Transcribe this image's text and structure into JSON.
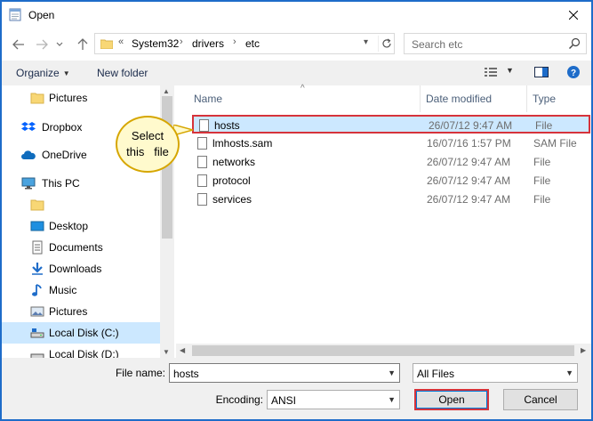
{
  "window": {
    "title": "Open"
  },
  "address": {
    "overflow": "«",
    "segments": [
      "System32",
      "drivers",
      "etc"
    ]
  },
  "search": {
    "placeholder": "Search etc"
  },
  "toolbar": {
    "organize": "Organize",
    "new_folder": "New folder"
  },
  "sidebar": {
    "items": [
      {
        "label": "Pictures",
        "icon": "folder-icon"
      },
      {
        "label": "Dropbox",
        "icon": "dropbox-icon"
      },
      {
        "label": "OneDrive",
        "icon": "onedrive-icon"
      },
      {
        "label": "This PC",
        "icon": "pc-icon"
      },
      {
        "label": "",
        "icon": "folder-icon"
      },
      {
        "label": "Desktop",
        "icon": "desktop-icon"
      },
      {
        "label": "Documents",
        "icon": "documents-icon"
      },
      {
        "label": "Downloads",
        "icon": "downloads-icon"
      },
      {
        "label": "Music",
        "icon": "music-icon"
      },
      {
        "label": "Pictures",
        "icon": "pictures-icon"
      },
      {
        "label": "Local Disk (C:)",
        "icon": "disk-icon",
        "selected": true
      },
      {
        "label": "Local Disk (D:)",
        "icon": "disk-icon"
      }
    ]
  },
  "columns": {
    "name": "Name",
    "date": "Date modified",
    "type": "Type"
  },
  "files": [
    {
      "name": "hosts",
      "date": "26/07/12 9:47 AM",
      "type": "File",
      "selected": true
    },
    {
      "name": "lmhosts.sam",
      "date": "16/07/16 1:57 PM",
      "type": "SAM File"
    },
    {
      "name": "networks",
      "date": "26/07/12 9:47 AM",
      "type": "File"
    },
    {
      "name": "protocol",
      "date": "26/07/12 9:47 AM",
      "type": "File"
    },
    {
      "name": "services",
      "date": "26/07/12 9:47 AM",
      "type": "File"
    }
  ],
  "callout": {
    "line1": "Select",
    "line2": "this   file"
  },
  "bottom": {
    "file_name_label": "File name:",
    "file_name_value": "hosts",
    "filter_value": "All Files",
    "encoding_label": "Encoding:",
    "encoding_value": "ANSI",
    "open_label": "Open",
    "cancel_label": "Cancel"
  },
  "colors": {
    "accent": "#1e6cc9",
    "highlight": "#d6333b",
    "selection": "#cce8ff",
    "callout": "#fffacd"
  }
}
